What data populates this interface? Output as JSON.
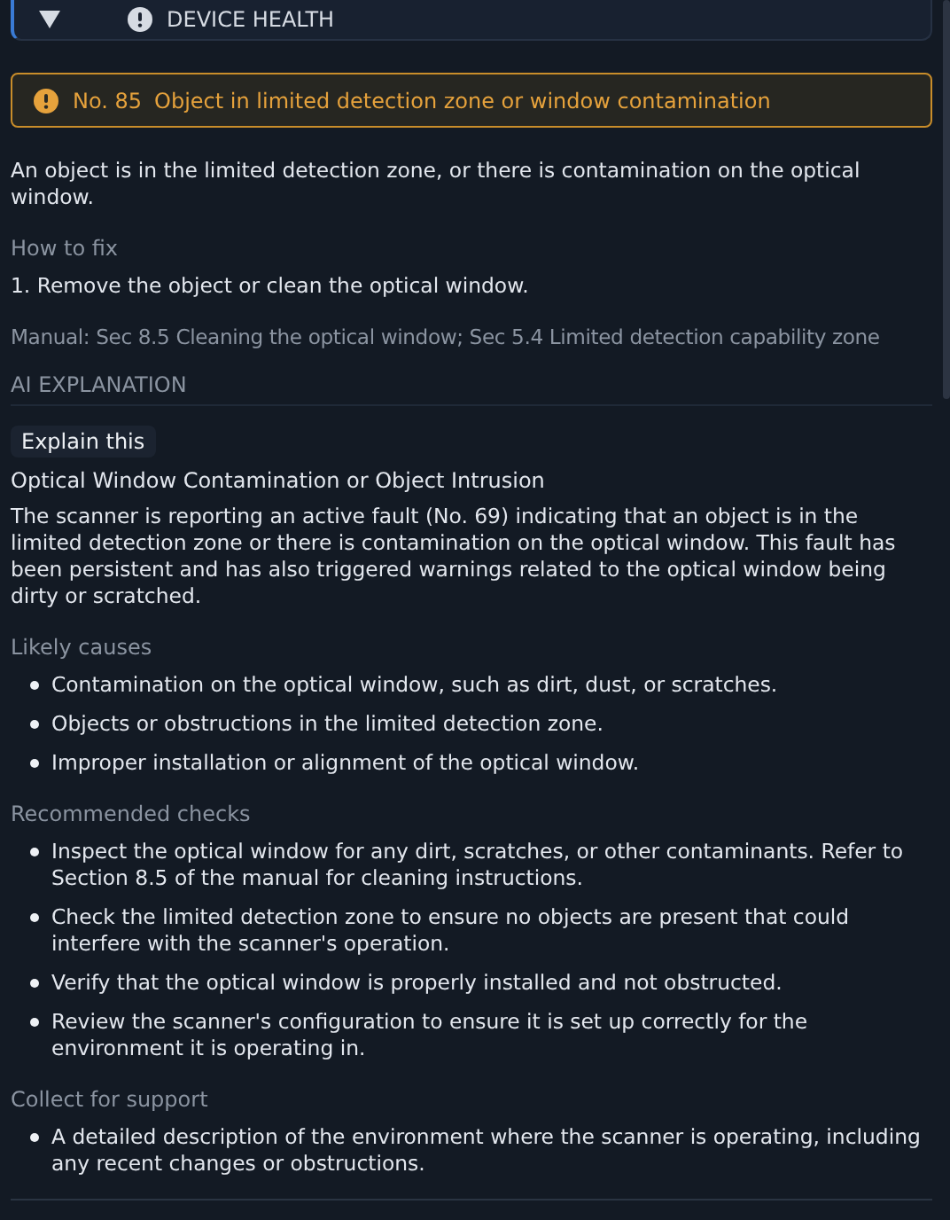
{
  "header": {
    "title": "DEVICE HEALTH",
    "expanded": true
  },
  "alert": {
    "number": "No. 85",
    "title": "Object in limited detection zone or window contamination"
  },
  "description": "An object is in the limited detection zone, or there is contamination on the optical window.",
  "how_to_fix": {
    "heading": "How to fix",
    "steps": [
      "1. Remove the object or clean the optical window."
    ]
  },
  "manual": "Manual: Sec 8.5 Cleaning the optical window; Sec 5.4 Limited detection capability zone",
  "ai": {
    "heading": "AI EXPLANATION",
    "button": "Explain this",
    "title": "Optical Window Contamination or Object Intrusion",
    "summary": "The scanner is reporting an active fault (No. 69) indicating that an object is in the limited detection zone or there is contamination on the optical window. This fault has been persistent and has also triggered warnings related to the optical window being dirty or scratched.",
    "sections": [
      {
        "heading": "Likely causes",
        "items": [
          "Contamination on the optical window, such as dirt, dust, or scratches.",
          "Objects or obstructions in the limited detection zone.",
          "Improper installation or alignment of the optical window."
        ]
      },
      {
        "heading": "Recommended checks",
        "items": [
          "Inspect the optical window for any dirt, scratches, or other contaminants. Refer to Section 8.5 of the manual for cleaning instructions.",
          "Check the limited detection zone to ensure no objects are present that could interfere with the scanner's operation.",
          "Verify that the optical window is properly installed and not obstructed.",
          "Review the scanner's configuration to ensure it is set up correctly for the environment it is operating in."
        ]
      },
      {
        "heading": "Collect for support",
        "items": [
          "A detailed description of the environment where the scanner is operating, including any recent changes or obstructions."
        ]
      }
    ]
  }
}
